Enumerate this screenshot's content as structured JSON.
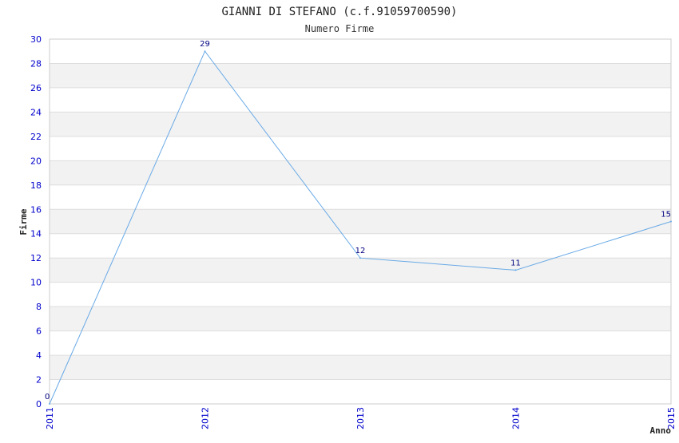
{
  "chart_data": {
    "type": "line",
    "title": "GIANNI DI STEFANO (c.f.91059700590)",
    "subtitle": "Numero Firme",
    "xlabel": "Anno",
    "ylabel": "Firme",
    "categories": [
      "2011",
      "2012",
      "2013",
      "2014",
      "2015"
    ],
    "series": [
      {
        "values": [
          0,
          29,
          12,
          11,
          15
        ]
      }
    ],
    "data_labels": [
      "0",
      "29",
      "12",
      "11",
      "15"
    ],
    "ylim": [
      0,
      30
    ],
    "yticks": [
      "0",
      "2",
      "4",
      "6",
      "8",
      "10",
      "12",
      "14",
      "16",
      "18",
      "20",
      "22",
      "24",
      "26",
      "28",
      "30"
    ],
    "grid": true,
    "colors": {
      "line": "#6aaae6",
      "band": "#f2f2f2",
      "grid": "#dddddd",
      "tick_text": "#0000cc",
      "data_label": "#000080"
    }
  }
}
